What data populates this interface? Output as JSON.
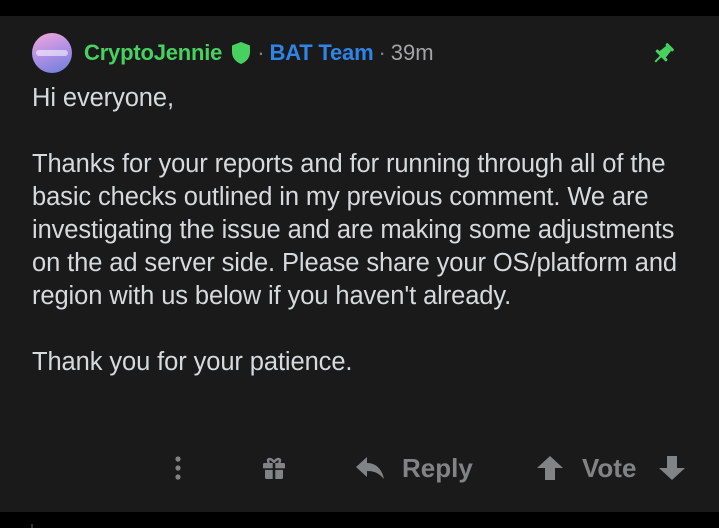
{
  "comment": {
    "author": "CryptoJennie",
    "separator": "·",
    "flair": "BAT Team",
    "time_ago": "39m",
    "paragraphs": [
      "Hi everyone,",
      "Thanks for your reports and for running through all of the basic checks outlined in my previous comment. We are investigating the issue and are making some adjustments on the ad server side. Please share your OS/platform and region with us below if you haven't already.",
      "Thank you for your patience."
    ]
  },
  "actions": {
    "reply_label": "Reply",
    "vote_label": "Vote"
  },
  "icons": {
    "avatar": "avatar-image",
    "moderator": "shield-icon",
    "pinned": "pin-icon",
    "more": "kebab-menu-icon",
    "award": "gift-icon",
    "reply": "reply-arrow-icon",
    "upvote": "upvote-arrow-icon",
    "downvote": "downvote-arrow-icon"
  },
  "colors": {
    "background": "#1a1a1b",
    "username": "#46d160",
    "flair": "#2f84e6",
    "body_text": "#d7dadc",
    "meta_text": "#a2a4a6",
    "action_text": "#818384"
  }
}
